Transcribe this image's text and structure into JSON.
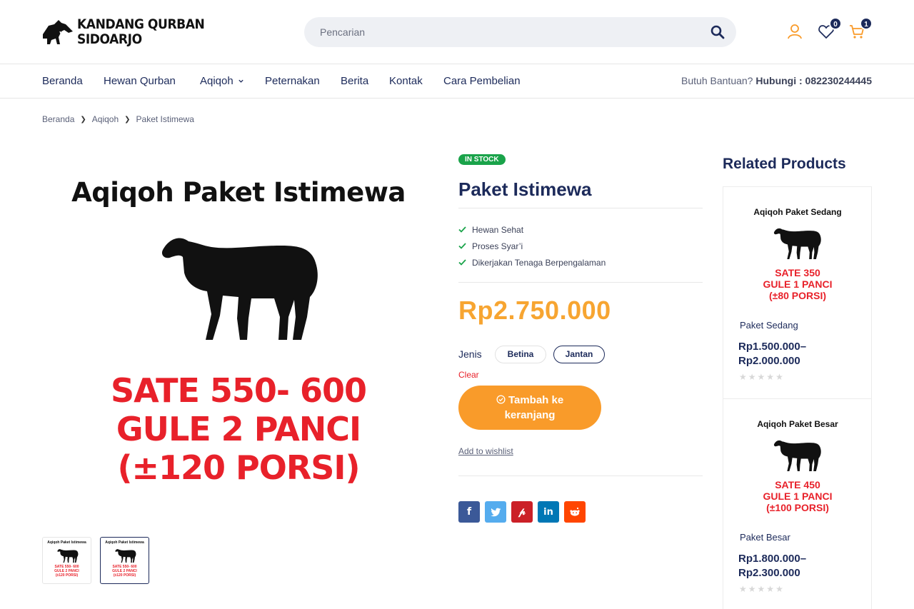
{
  "header": {
    "logo_line1": "KANDANG QURBAN",
    "logo_line2": "SIDOARJO",
    "search_placeholder": "Pencarian",
    "wishlist_count": "0",
    "cart_count": "1"
  },
  "nav": {
    "items": [
      "Beranda",
      "Hewan Qurban",
      "Aqiqoh",
      "Peternakan",
      "Berita",
      "Kontak",
      "Cara Pembelian"
    ],
    "help_prefix": "Butuh Bantuan?",
    "help_contact": "Hubungi : 082230244445"
  },
  "breadcrumb": [
    "Beranda",
    "Aqiqoh",
    "Paket Istimewa"
  ],
  "product": {
    "image_title": "Aqiqoh Paket Istimewa",
    "image_lines": [
      "SATE 550- 600",
      "GULE 2 PANCI",
      "(±120 PORSI)"
    ],
    "stock": "IN STOCK",
    "title": "Paket Istimewa",
    "features": [
      "Hewan Sehat",
      "Proses Syar’i",
      "Dikerjakan Tenaga Berpengalaman"
    ],
    "price": "Rp2.750.000",
    "variant_label": "Jenis",
    "variants": [
      "Betina",
      "Jantan"
    ],
    "selected_variant": "Jantan",
    "clear": "Clear",
    "add_to_cart": "Tambah ke keranjang",
    "add_to_wishlist": "Add to wishlist"
  },
  "related": {
    "title": "Related Products",
    "items": [
      {
        "image_title": "Aqiqoh Paket Sedang",
        "image_lines": [
          "SATE 350",
          "GULE 1 PANCI",
          "(±80 PORSI)"
        ],
        "name": "Paket Sedang",
        "price_line1": "Rp1.500.000–",
        "price_line2": "Rp2.000.000",
        "rating": 0
      },
      {
        "image_title": "Aqiqoh Paket Besar",
        "image_lines": [
          "SATE 450",
          "GULE 1 PANCI",
          "(±100 PORSI)"
        ],
        "name": "Paket Besar",
        "price_line1": "Rp1.800.000–",
        "price_line2": "Rp2.300.000",
        "rating": 0
      }
    ]
  },
  "share": [
    "facebook-icon",
    "twitter-icon",
    "pinterest-icon",
    "linkedin-icon",
    "reddit-icon"
  ],
  "colors": {
    "navy": "#1c2a5a",
    "orange": "#f99b2a",
    "price": "#f7a531",
    "stock_green": "#1aa34a",
    "red": "#e8212a"
  }
}
